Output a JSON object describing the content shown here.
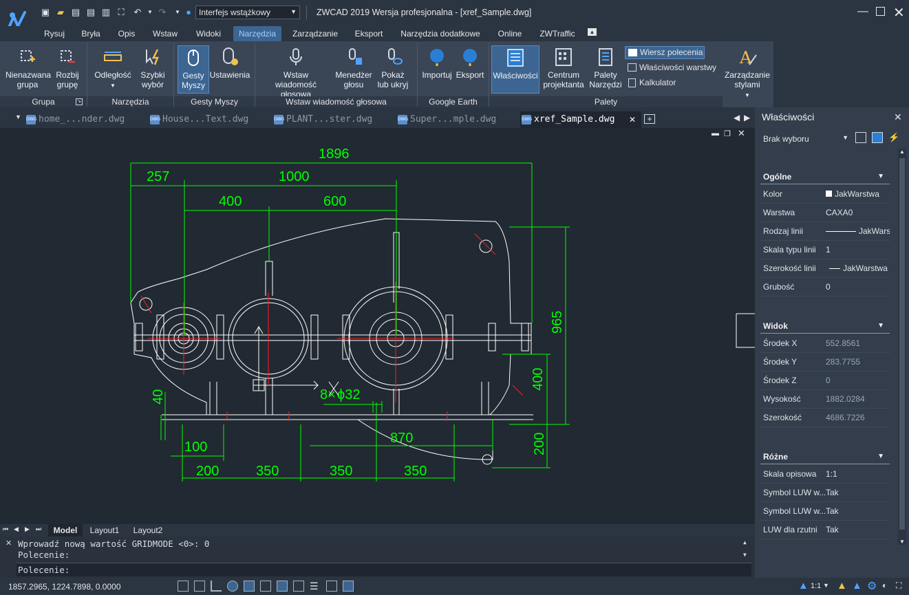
{
  "titlebar": {
    "workspace": "Interfejs wstążkowy",
    "title": "ZWCAD 2019 Wersja profesjonalna - [xref_Sample.dwg]"
  },
  "menu": [
    "Rysuj",
    "Bryła",
    "Opis",
    "Wstaw",
    "Widoki",
    "Narzędzia",
    "Zarządzanie",
    "Eksport",
    "Narzędzia dodatkowe",
    "Online",
    "ZWTraffic"
  ],
  "menu_active": "Narzędzia",
  "ribbon": {
    "buttons": {
      "unnamed_group": "Nienazwana grupa",
      "ungroup": "Rozbij grupę",
      "distance": "Odległość",
      "quick_select": "Szybki wybór",
      "mouse_gestures": "Gesty Myszy",
      "settings": "Ustawienia",
      "insert_voice": "Wstaw wiadomość głosowa",
      "voice_manager": "Menedżer głosu",
      "show_hide": "Pokaż lub ukryj",
      "import": "Importuj",
      "export": "Eksport",
      "properties": "Właściwości",
      "design_center": "Centrum projektanta",
      "tool_palettes": "Palety Narzędzi",
      "command_line": "Wiersz polecenia",
      "layer_properties": "Właściwości warstwy",
      "calculator": "Kalkulator",
      "style_manager": "Zarządzanie stylami"
    },
    "groups": {
      "group": "Grupa",
      "tools": "Narzędzia",
      "gestures": "Gesty Myszy",
      "voice": "Wstaw wiadomość głosowa",
      "google": "Google Earth",
      "palettes": "Palety"
    }
  },
  "doc_tabs": [
    "home_...nder.dwg",
    "House...Text.dwg",
    "PLANT...ster.dwg",
    "Super...mple.dwg",
    "xref_Sample.dwg"
  ],
  "dwg_badge": "DWG",
  "drawing": {
    "dims": [
      "1896",
      "257",
      "1000",
      "400",
      "600",
      "965",
      "400",
      "40",
      "8×",
      "ϕ32",
      "870",
      "200",
      "100",
      "200",
      "350",
      "350",
      "350"
    ]
  },
  "layout_tabs": [
    "Model",
    "Layout1",
    "Layout2"
  ],
  "command": {
    "history": [
      "Wprowadź nową wartość GRIDMODE  <0>: 0",
      "Polecenie:"
    ],
    "prompt": "Polecenie:"
  },
  "status": {
    "coords": "1857.2965, 1224.7898, 0.0000",
    "scale": "1:1"
  },
  "properties": {
    "title": "Właściwości",
    "selection": "Brak wyboru",
    "sections": [
      {
        "name": "Ogólne",
        "rows": [
          {
            "name": "Kolor",
            "value": "JakWarstwa"
          },
          {
            "name": "Warstwa",
            "value": "CAXA0"
          },
          {
            "name": "Rodzaj linii",
            "value": "JakWarstwa"
          },
          {
            "name": "Skala typu linii",
            "value": "1"
          },
          {
            "name": "Szerokość linii",
            "value": "JakWarstwa"
          },
          {
            "name": "Grubość",
            "value": "0"
          }
        ]
      },
      {
        "name": "Widok",
        "rows": [
          {
            "name": "Środek X",
            "value": "552.8561"
          },
          {
            "name": "Środek Y",
            "value": "283.7755"
          },
          {
            "name": "Środek Z",
            "value": "0"
          },
          {
            "name": "Wysokość",
            "value": "1882.0284"
          },
          {
            "name": "Szerokość",
            "value": "4686.7226"
          }
        ]
      },
      {
        "name": "Różne",
        "rows": [
          {
            "name": "Skala opisowa",
            "value": "1:1"
          },
          {
            "name": "Symbol LUW w...",
            "value": "Tak"
          },
          {
            "name": "Symbol LUW w...",
            "value": "Tak"
          },
          {
            "name": "LUW dla rzutni",
            "value": "Tak"
          }
        ]
      }
    ]
  },
  "colors": {
    "accent": "#3d6591",
    "dim": "#00ff00",
    "center": "#ff2020"
  }
}
